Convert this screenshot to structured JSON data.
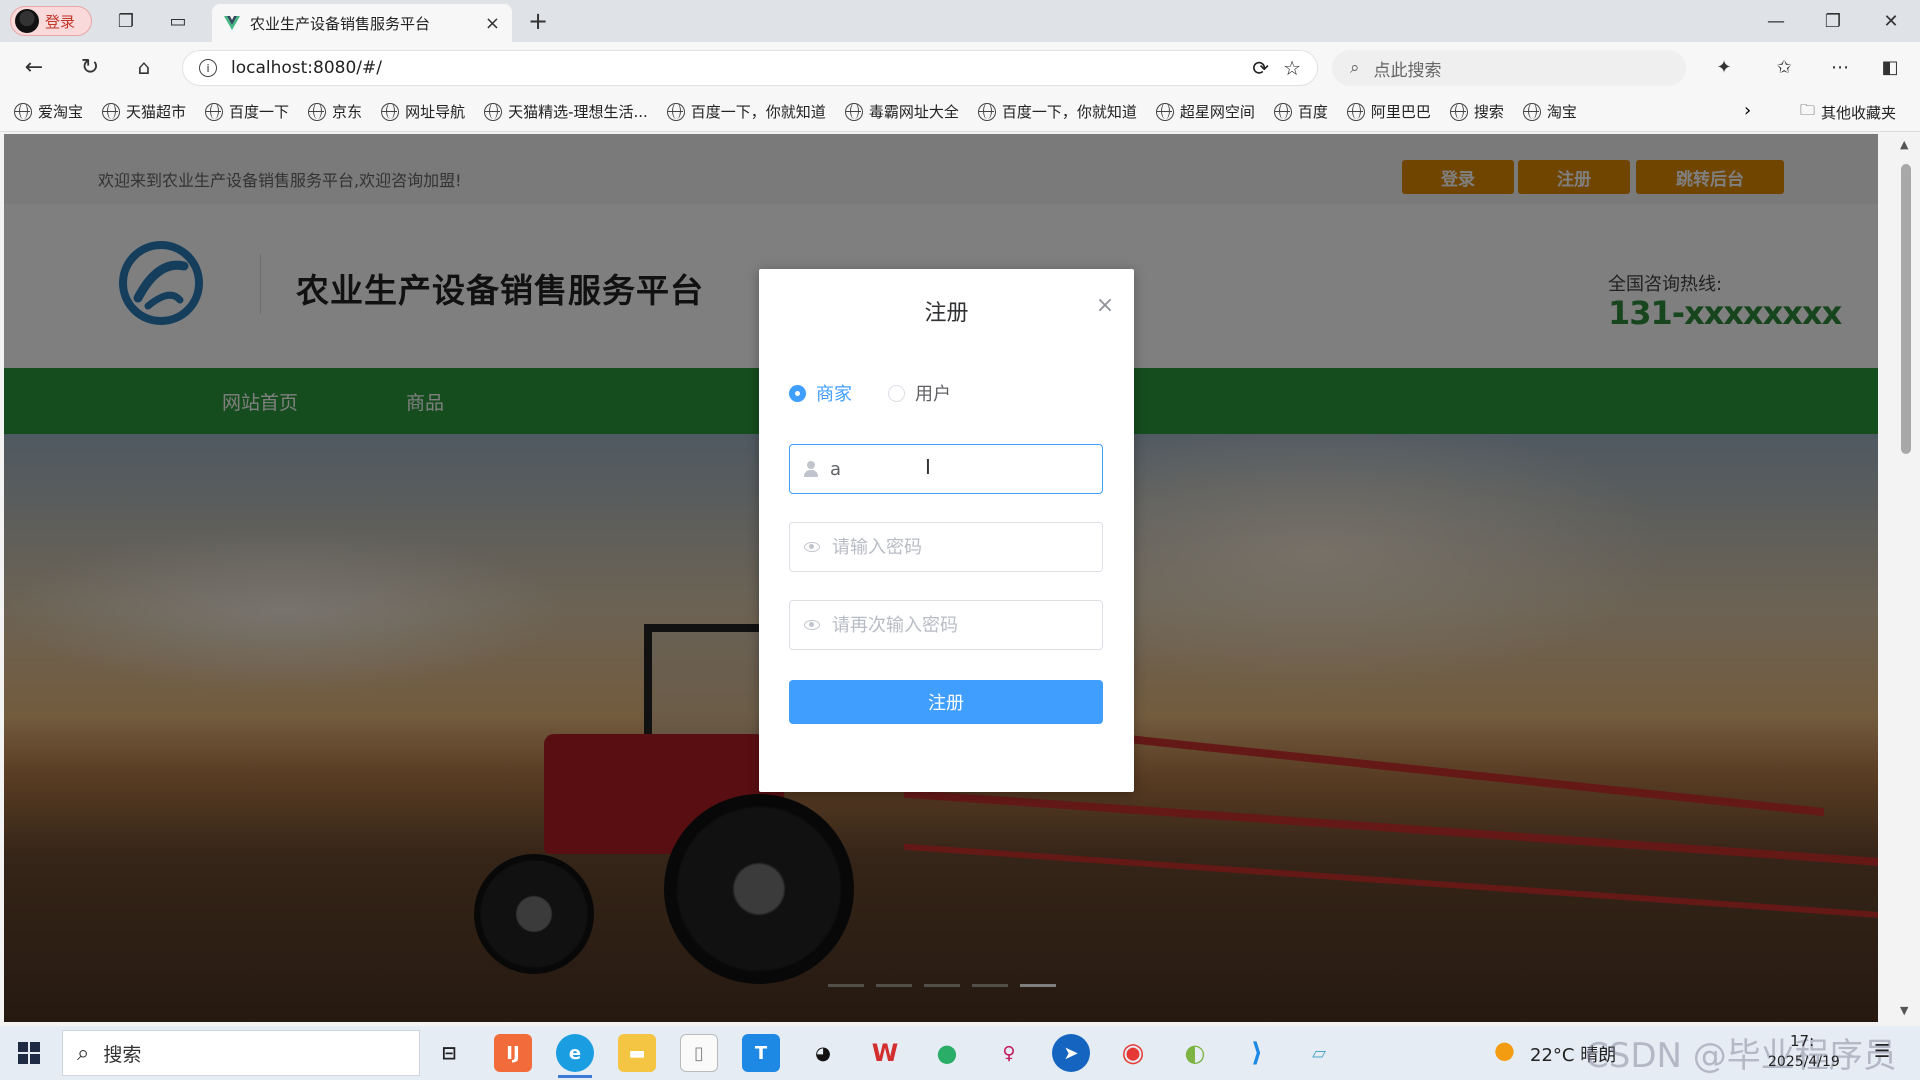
{
  "browser": {
    "profile_label": "登录",
    "tab_title": "农业生产设备销售服务平台",
    "tab_close": "×",
    "new_tab": "+",
    "url": "localhost:8080/#/",
    "search_placeholder": "点此搜索",
    "bookmarks": [
      "爱淘宝",
      "天猫超市",
      "百度一下",
      "京东",
      "网址导航",
      "天猫精选-理想生活...",
      "百度一下，你就知道",
      "毒霸网址大全",
      "百度一下，你就知道",
      "超星网空间",
      "百度",
      "阿里巴巴",
      "搜索",
      "淘宝"
    ],
    "bookmarks_more": "›",
    "other_bookmarks": "其他收藏夹"
  },
  "site": {
    "welcome": "欢迎来到农业生产设备销售服务平台,欢迎咨询加盟!",
    "top_buttons": {
      "login": "登录",
      "register": "注册",
      "admin": "跳转后台"
    },
    "title": "农业生产设备销售服务平台",
    "hotline_label": "全国咨询热线:",
    "hotline_number": "131-xxxxxxxx",
    "nav": [
      "网站首页",
      "商品"
    ],
    "accent_color": "#2d9a3c",
    "button_color": "#e08a00"
  },
  "modal": {
    "title": "注册",
    "close": "×",
    "role_options": [
      {
        "label": "商家",
        "checked": true
      },
      {
        "label": "用户",
        "checked": false
      }
    ],
    "username_value": "a",
    "password_placeholder": "请输入密码",
    "confirm_placeholder": "请再次输入密码",
    "submit": "注册",
    "primary_color": "#409eff"
  },
  "taskbar": {
    "search_label": "搜索",
    "weather": "22°C 晴朗",
    "watermark": "CSDN @毕业程序员",
    "time": "17:",
    "date": "2025/4/19"
  }
}
